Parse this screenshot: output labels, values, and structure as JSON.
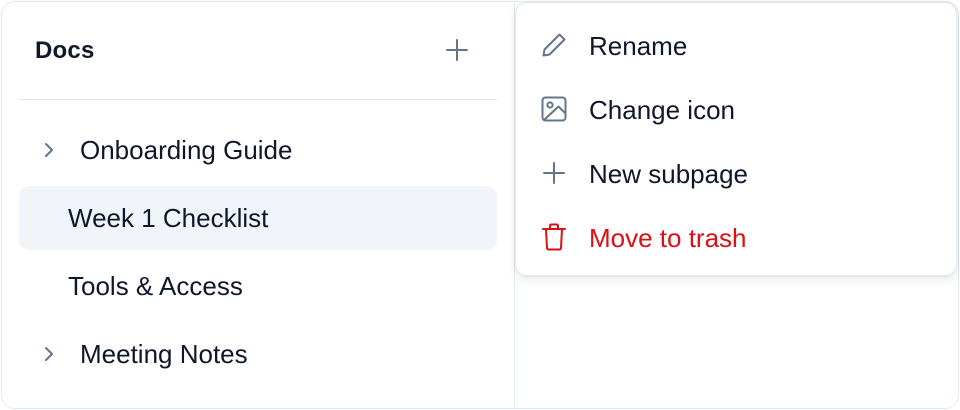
{
  "sidebar": {
    "title": "Docs",
    "add_icon": "plus-icon",
    "items": [
      {
        "label": "Onboarding Guide",
        "expandable": true,
        "active": false,
        "icon": "chevron-right-icon"
      },
      {
        "label": "Week 1 Checklist",
        "expandable": false,
        "active": true
      },
      {
        "label": "Tools & Access",
        "expandable": false,
        "active": false
      },
      {
        "label": "Meeting Notes",
        "expandable": true,
        "active": false,
        "icon": "chevron-right-icon"
      }
    ]
  },
  "context_menu": {
    "items": [
      {
        "label": "Rename",
        "icon": "pencil-icon"
      },
      {
        "label": "Change icon",
        "icon": "image-icon"
      },
      {
        "label": "New subpage",
        "icon": "plus-icon"
      },
      {
        "label": "Move to trash",
        "icon": "trash-icon",
        "danger": true
      }
    ]
  },
  "colors": {
    "text": "#0f172a",
    "icon": "#64748b",
    "active_bg": "#f1f4f8",
    "border": "#e2e8f0",
    "danger": "#dc0f16"
  }
}
